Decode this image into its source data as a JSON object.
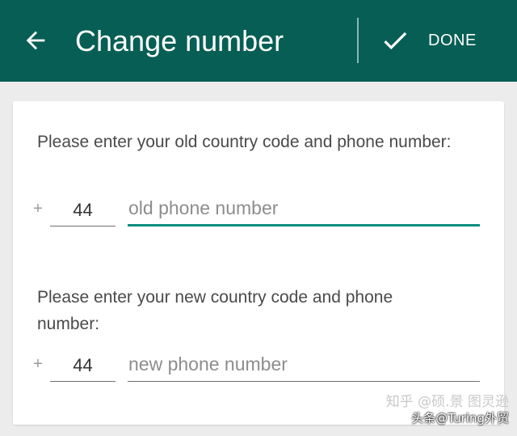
{
  "appbar": {
    "back_icon": "arrow-back-icon",
    "title": "Change number",
    "done_icon": "check-icon",
    "done_label": "DONE",
    "background_color": "#075e54",
    "text_color": "#ffffff"
  },
  "old_number": {
    "prompt": "Please enter your old country code and phone number:",
    "plus": "+",
    "country_code": "44",
    "phone_placeholder": "old phone number",
    "phone_value": ""
  },
  "new_number": {
    "prompt": "Please enter your new country code and phone number:",
    "plus": "+",
    "country_code": "44",
    "phone_placeholder": "new phone number",
    "phone_value": ""
  },
  "accent_color": "#0c8e80",
  "watermark": {
    "line1": "知乎 @硕.景 图灵逊",
    "line2": "头条@Turing外贸"
  }
}
